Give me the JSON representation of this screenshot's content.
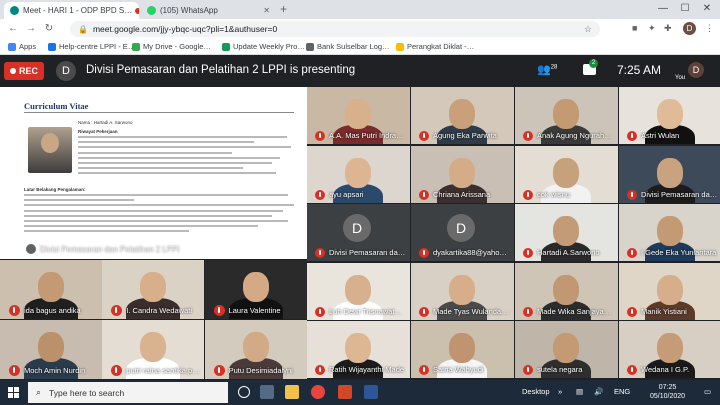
{
  "browser": {
    "tabs": [
      {
        "label": "Meet - HARI 1 - ODP BPD S…",
        "active": true
      },
      {
        "label": "(105) WhatsApp",
        "active": false
      }
    ],
    "new_tab": "+",
    "url": "meet.google.com/jjy-ybqc-uqc?pli=1&authuser=0",
    "profile_initial": "D",
    "bookmarks": [
      {
        "label": "Apps",
        "color": "#4285f4"
      },
      {
        "label": "Help-centre LPPI - E…",
        "color": "#1a73e8"
      },
      {
        "label": "My Drive - Google…",
        "color": "#34a853"
      },
      {
        "label": "Update Weekly Pro…",
        "color": "#0f9d58"
      },
      {
        "label": "Bank Sulselbar Log…",
        "color": "#5f6368"
      },
      {
        "label": "Perangkat Diklat -…",
        "color": "#fbbc04"
      }
    ]
  },
  "meet": {
    "rec_label": "REC",
    "presenter_initial": "D",
    "presenting_text": "Divisi Pemasaran dan Pelatihan 2 LPPI is presenting",
    "participant_count": "28",
    "chat_badge": "2",
    "time": "7:25 AM",
    "you_initial": "D",
    "you_label": "You"
  },
  "slide": {
    "title": "Curriculum Vitae",
    "name_line": "Nama          :  Hartadi A. Sarwono",
    "section_riwayat": "Riwayat Pekerjaan",
    "section_latar": "Latar Belakang Pengalaman:",
    "caption": "Divisi Pemasaran dan Pelatihan 2 LPPI"
  },
  "tiles_top": [
    {
      "name": "A.A. Mas Putri Indra…",
      "bg": "#c9b8a3",
      "skin": "#d9b08c",
      "shirt": "#7a2b2b"
    },
    {
      "name": "Agung Eka Parwita",
      "bg": "#d4c8bb",
      "skin": "#caa07a",
      "shirt": "#2f3b48"
    },
    {
      "name": "Anak Agung Ngurah…",
      "bg": "#ccc4b8",
      "skin": "#c49a72",
      "shirt": "#3a3a3a"
    },
    {
      "name": "Astri Wulan",
      "bg": "#e7e2dc",
      "skin": "#e0bb98",
      "shirt": "#111111"
    },
    {
      "name": "ayu apsari",
      "bg": "#dcd6cf",
      "skin": "#ddb592",
      "shirt": "#2b4a6b"
    },
    {
      "name": "Chriana Arissana",
      "bg": "#c9bfb4",
      "skin": "#d4ac88",
      "shirt": "#3c2f2f"
    },
    {
      "name": "cok wisnu",
      "bg": "#e3ddd4",
      "skin": "#c7a07c",
      "shirt": "#f2f2f2"
    },
    {
      "name": "Divisi Pemasaran da…",
      "bg": "#3d4a5a",
      "skin": "#c9a280",
      "shirt": "#1c1c1c"
    },
    {
      "name": "Divisi Pemasaran da…",
      "bg": "#3c4043",
      "avatar": "D"
    },
    {
      "name": "dyakartika88@yaho…",
      "bg": "#3c4043",
      "avatar": "D"
    },
    {
      "name": "Hartadi A.Sarwono",
      "bg": "#e4e4e0",
      "skin": "#c49b77",
      "shirt": "#2a2a2a"
    },
    {
      "name": "I Gede Eka Yuniantara",
      "bg": "#d8d3cb",
      "skin": "#c39a74",
      "shirt": "#1f3a5a"
    },
    {
      "name": "Luh Dewi Trisnawat…",
      "bg": "#e9e4dc",
      "skin": "#d8b08e",
      "shirt": "#ffffff"
    },
    {
      "name": "Made Tyas Wulanda…",
      "bg": "#d9d0c5",
      "skin": "#d7ad8a",
      "shirt": "#4a4a4a"
    },
    {
      "name": "Made Wika Sanjaya…",
      "bg": "#cfc5b7",
      "skin": "#c29874",
      "shirt": "#2c2c2c"
    },
    {
      "name": "Manik Yistiani",
      "bg": "#e0d6c8",
      "skin": "#d6ae8c",
      "shirt": "#5b3a2a"
    },
    {
      "name": "Ratih Wijayanthi Made",
      "bg": "#e6e0d8",
      "skin": "#ddb693",
      "shirt": "#1b1b1b"
    },
    {
      "name": "Satria Wahyudi",
      "bg": "#cbbfae",
      "skin": "#c09470",
      "shirt": "#f5f5f5"
    },
    {
      "name": "sutela negara",
      "bg": "#bfb5a8",
      "skin": "#c49a75",
      "shirt": "#2e2e2e"
    },
    {
      "name": "Wedana I G.P.",
      "bg": "#d7cfc3",
      "skin": "#c69c78",
      "shirt": "#1a1a1a"
    }
  ],
  "tiles_bottom": [
    {
      "name": "ida bagus andika",
      "bg": "#cdbfae",
      "skin": "#c39a74",
      "shirt": "#1f1f1f"
    },
    {
      "name": "I. Candra Wedawati",
      "bg": "#dbd2c6",
      "skin": "#d8af8b",
      "shirt": "#3a2d2d"
    },
    {
      "name": "Laura Valentine",
      "bg": "#2a2a2a",
      "skin": "#d4aa86",
      "shirt": "#111111"
    },
    {
      "name": "Moch Amin Nurdin",
      "bg": "#c7bcaf",
      "skin": "#bb916c",
      "shirt": "#2a3b4c"
    },
    {
      "name": "putri ratna santika p…",
      "bg": "#e4ddd3",
      "skin": "#d9b390",
      "shirt": "#ffffff"
    },
    {
      "name": "Putu Desimiadalyni",
      "bg": "#d4cbbf",
      "skin": "#d3aa86",
      "shirt": "#4a3a3a"
    }
  ],
  "taskbar": {
    "search_placeholder": "Type here to search",
    "desktop_label": "Desktop",
    "lang": "ENG",
    "time": "07:25",
    "date": "05/10/2020"
  }
}
